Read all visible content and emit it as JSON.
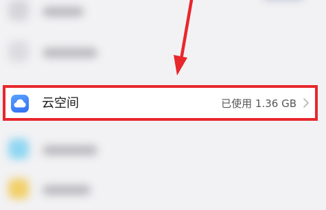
{
  "settings": {
    "cloud_item": {
      "label": "云空间",
      "usage": "已使用 1.36 GB",
      "icon": "cloud-icon",
      "chevron_icon": "chevron-right-icon"
    }
  },
  "annotation": {
    "highlight_color": "#e8272c",
    "arrow_icon": "red-arrow-icon"
  }
}
